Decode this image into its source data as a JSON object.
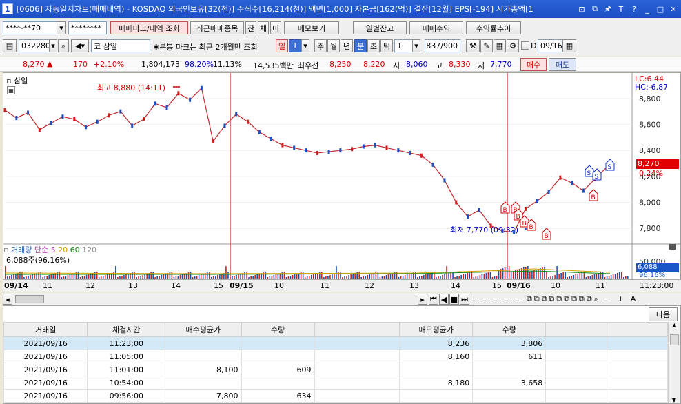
{
  "window": {
    "number": "1",
    "title": "[0606] 자동일지차트(매매내역) - KOSDAQ 외국인보유[32(천)] 주식수[16,214(천)] 액면[1,000] 자본금[162(억)] 결산[12월] EPS[-194] 시가총액[1"
  },
  "toolbar1": {
    "account": "****-**70",
    "password": "********",
    "btn_trade_marks": "매매마크/내역 조회",
    "btn_recent": "최근매매종목",
    "btn_jan": "잔",
    "btn_che": "체",
    "btn_mi": "미",
    "btn_memo": "메모보기",
    "btn_daily_balance": "일별잔고",
    "btn_trade_profit": "매매수익",
    "btn_return_trend": "수익률추이"
  },
  "toolbar2": {
    "code": "032280",
    "market": "코",
    "name": "삼일",
    "note": "✱분봉 마크는 최근 2개월만 조회",
    "period_day": "일",
    "period_num": "1",
    "tab_week": "주",
    "tab_month": "월",
    "tab_year": "년",
    "tab_min": "분",
    "tab_sec": "초",
    "tab_tick": "틱",
    "interval": "1",
    "count": "837/900",
    "d_label": "D",
    "date": "09/16"
  },
  "info": {
    "price": "8,270",
    "arrow": "▲",
    "change": "170",
    "rate": "+2.10%",
    "volume": "1,804,173",
    "vol_ratio": "98.20%",
    "turnover": "11.13%",
    "amount": "14,535백만",
    "quote_label": "최우선",
    "ask": "8,250",
    "bid": "8,220",
    "open_label": "시",
    "open": "8,060",
    "high_label": "고",
    "high": "8,330",
    "low_label": "저",
    "low": "7,770",
    "buy": "매수",
    "sell": "매도"
  },
  "chart": {
    "name": "삼일",
    "lc": "LC:6.44",
    "hc": "HC:-6.87",
    "high_annot": "최고 8,880 (14:11)",
    "low_annot": "최저 7,770 (09:32)",
    "current_price": "8,270",
    "current_rate": "0.24%",
    "y_labels": [
      "8,800",
      "8,600",
      "8,400",
      "8,200",
      "8,000",
      "7,800"
    ],
    "vol_legend": {
      "label": "거래량",
      "ma": "단순 5",
      "m20": "20",
      "m60": "60",
      "m120": "120",
      "value": "6,088주(96.16%)"
    },
    "vol_axis": [
      "50,000"
    ],
    "vol_current": "6,088",
    "vol_rate": "96.16%",
    "time_labels": [
      "09/14",
      "11",
      "12",
      "13",
      "14",
      "15",
      "09/15",
      "10",
      "11",
      "12",
      "13",
      "14",
      "15",
      "09/16",
      "10",
      "11"
    ],
    "time_end": "11:23:00"
  },
  "chart_data": {
    "type": "line",
    "title": "삼일",
    "series": [
      {
        "values": [
          8710,
          8650,
          8690,
          8560,
          8610,
          8660,
          8640,
          8580,
          8620,
          8670,
          8700,
          8590,
          8640,
          8760,
          8730,
          8840,
          8790,
          8880,
          8470,
          8590,
          8680,
          8620,
          8540,
          8490,
          8440,
          8420,
          8400,
          8380,
          8390,
          8400,
          8410,
          8430,
          8440,
          8420,
          8400,
          8380,
          8360,
          8290,
          8170,
          8000,
          7890,
          7940,
          7820,
          7780,
          7770,
          7950,
          8010,
          8080,
          8190,
          8150,
          8090,
          8180,
          8270
        ]
      }
    ],
    "ylim": [
      7700,
      8900
    ]
  },
  "grid": {
    "next": "다음",
    "headers": [
      "거래일",
      "체결시간",
      "매수평균가",
      "수량",
      "",
      "매도평균가",
      "수량"
    ],
    "rows": [
      [
        "2021/09/16",
        "11:23:00",
        "",
        "",
        "",
        "8,236",
        "3,806"
      ],
      [
        "2021/09/16",
        "11:05:00",
        "",
        "",
        "",
        "8,160",
        "611"
      ],
      [
        "2021/09/16",
        "11:01:00",
        "8,100",
        "609",
        "",
        "",
        ""
      ],
      [
        "2021/09/16",
        "10:54:00",
        "",
        "",
        "",
        "8,180",
        "3,658"
      ],
      [
        "2021/09/16",
        "09:56:00",
        "7,800",
        "634",
        "",
        "",
        ""
      ]
    ]
  }
}
